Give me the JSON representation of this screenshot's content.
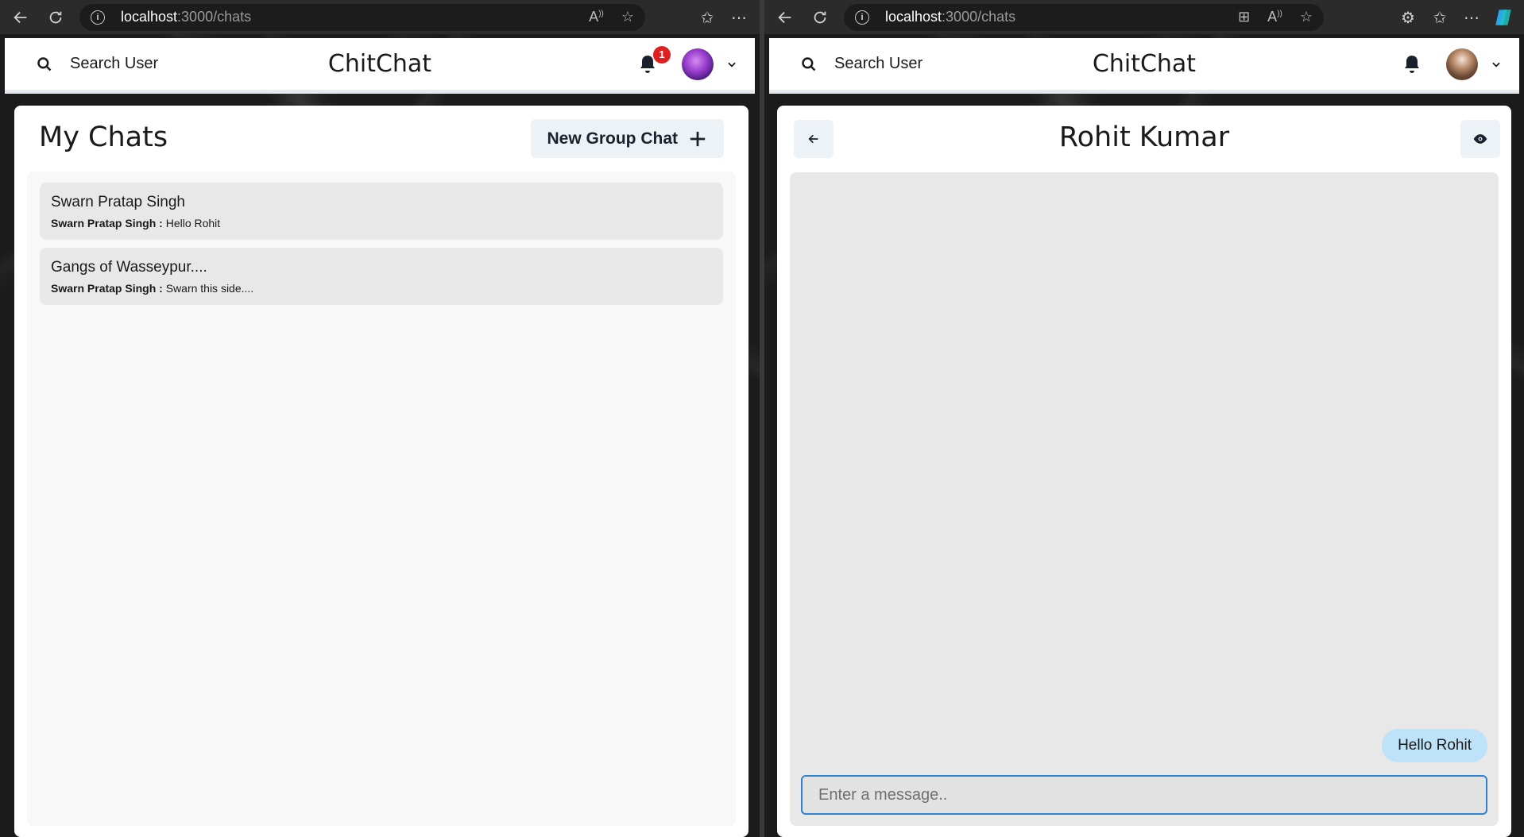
{
  "left_window": {
    "address": {
      "host": "localhost",
      "path": ":3000/chats"
    },
    "header": {
      "search_label": "Search User",
      "brand": "ChitChat",
      "notification_count": "1"
    },
    "mychats": {
      "title": "My Chats",
      "new_group_label": "New Group Chat",
      "chats": [
        {
          "name": "Swarn Pratap Singh",
          "sender": "Swarn Pratap Singh :",
          "message": "Hello Rohit"
        },
        {
          "name": "Gangs of Wasseypur....",
          "sender": "Swarn Pratap Singh :",
          "message": "Swarn this side...."
        }
      ]
    }
  },
  "right_window": {
    "address": {
      "host": "localhost",
      "path": ":3000/chats"
    },
    "header": {
      "search_label": "Search User",
      "brand": "ChitChat"
    },
    "chat": {
      "title": "Rohit Kumar",
      "messages": [
        {
          "text": "Hello Rohit",
          "own": true
        }
      ],
      "input_placeholder": "Enter a message.."
    }
  },
  "colors": {
    "badge": "#e02020",
    "bubble": "#bee3f8",
    "input_border": "#3182ce"
  }
}
